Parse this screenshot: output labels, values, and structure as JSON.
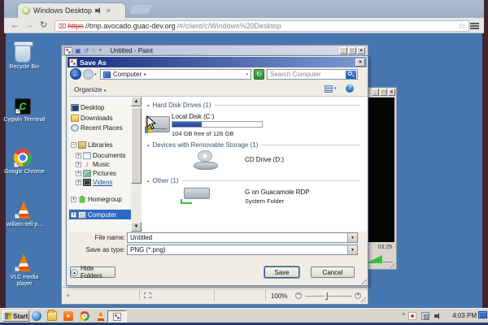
{
  "browser": {
    "tab_title": "Windows Desktop",
    "url": {
      "scheme": "https",
      "host": "//tmp.avocado.guac-dev.org",
      "path": "/#/client/c/Windows%20Desktop"
    },
    "back_glyph": "←",
    "forward_glyph": "→",
    "reload_glyph": "↻",
    "star_glyph": "☆"
  },
  "desktop": {
    "icons": [
      {
        "label": "Recycle Bin"
      },
      {
        "label": "Cygwin Terminal"
      },
      {
        "label": "Google Chrome"
      },
      {
        "label": "william-tell-p..."
      },
      {
        "label": "VLC media player"
      }
    ]
  },
  "paint": {
    "title": "Untitled - Paint",
    "zoom_level": "100%",
    "minimize_glyph": "_",
    "maximize_glyph": "□",
    "close_glyph": "×"
  },
  "vlc": {
    "time": "03:29"
  },
  "dialog": {
    "title": "Save As",
    "breadcrumb_root": "Computer",
    "breadcrumb_sep": "▸",
    "search_placeholder": "Search Computer",
    "organize_label": "Organize",
    "help_glyph": "?",
    "tree": [
      "Desktop",
      "Downloads",
      "Recent Places",
      "Libraries",
      "Documents",
      "Music",
      "Pictures",
      "Videos",
      "Homegroup",
      "Computer"
    ],
    "groups": [
      "Hard Disk Drives (1)",
      "Devices with Removable Storage (1)",
      "Other (1)"
    ],
    "local_disk": {
      "name": "Local Disk (C:)",
      "free_text": "104 GB free of 126 GB",
      "used_pct": 33
    },
    "cd_drive": {
      "name": "CD Drive (D:)"
    },
    "g_drive": {
      "name": "G on Guacamole RDP",
      "type": "System Folder"
    },
    "file_name_label": "File name:",
    "file_name_value": "Untitled",
    "save_type_label": "Save as type:",
    "save_type_value": "PNG (*.png)",
    "hide_folders_label": "Hide Folders",
    "save_label": "Save",
    "cancel_label": "Cancel"
  },
  "taskbar": {
    "start_label": "Start",
    "clock": "4:03 PM"
  },
  "colors": {
    "desktop_blue": "#4676AF",
    "frame_maroon": "#402530",
    "selection_blue": "#2E68C5",
    "dialog_title_gradient": [
      "#172F80",
      "#7C9BD2"
    ],
    "disk_fill": "#2B50A8",
    "vlc_volume_green": "#35C13F",
    "refresh_green": "#3BA53B"
  }
}
